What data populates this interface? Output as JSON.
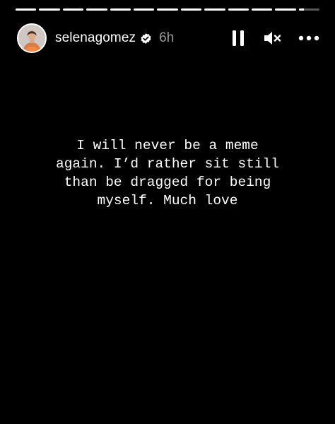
{
  "story": {
    "progress": {
      "segment_count": 13,
      "active_index": 12,
      "active_fraction": 0.25
    },
    "header": {
      "username": "selenagomez",
      "verified": true,
      "time_ago": "6h",
      "avatar_icon": "profile-photo",
      "controls": {
        "pause_icon": "pause-icon",
        "mute_icon": "volume-muted-icon",
        "more_icon": "more-options-icon"
      }
    },
    "caption_lines": [
      "I will never be a meme",
      "again. I’d rather sit still",
      "than be dragged for being",
      "myself. Much love"
    ],
    "colors": {
      "background": "#000000",
      "text": "#ffffff",
      "time": "#9a9a9a",
      "verified_badge": "#ffffff"
    }
  }
}
